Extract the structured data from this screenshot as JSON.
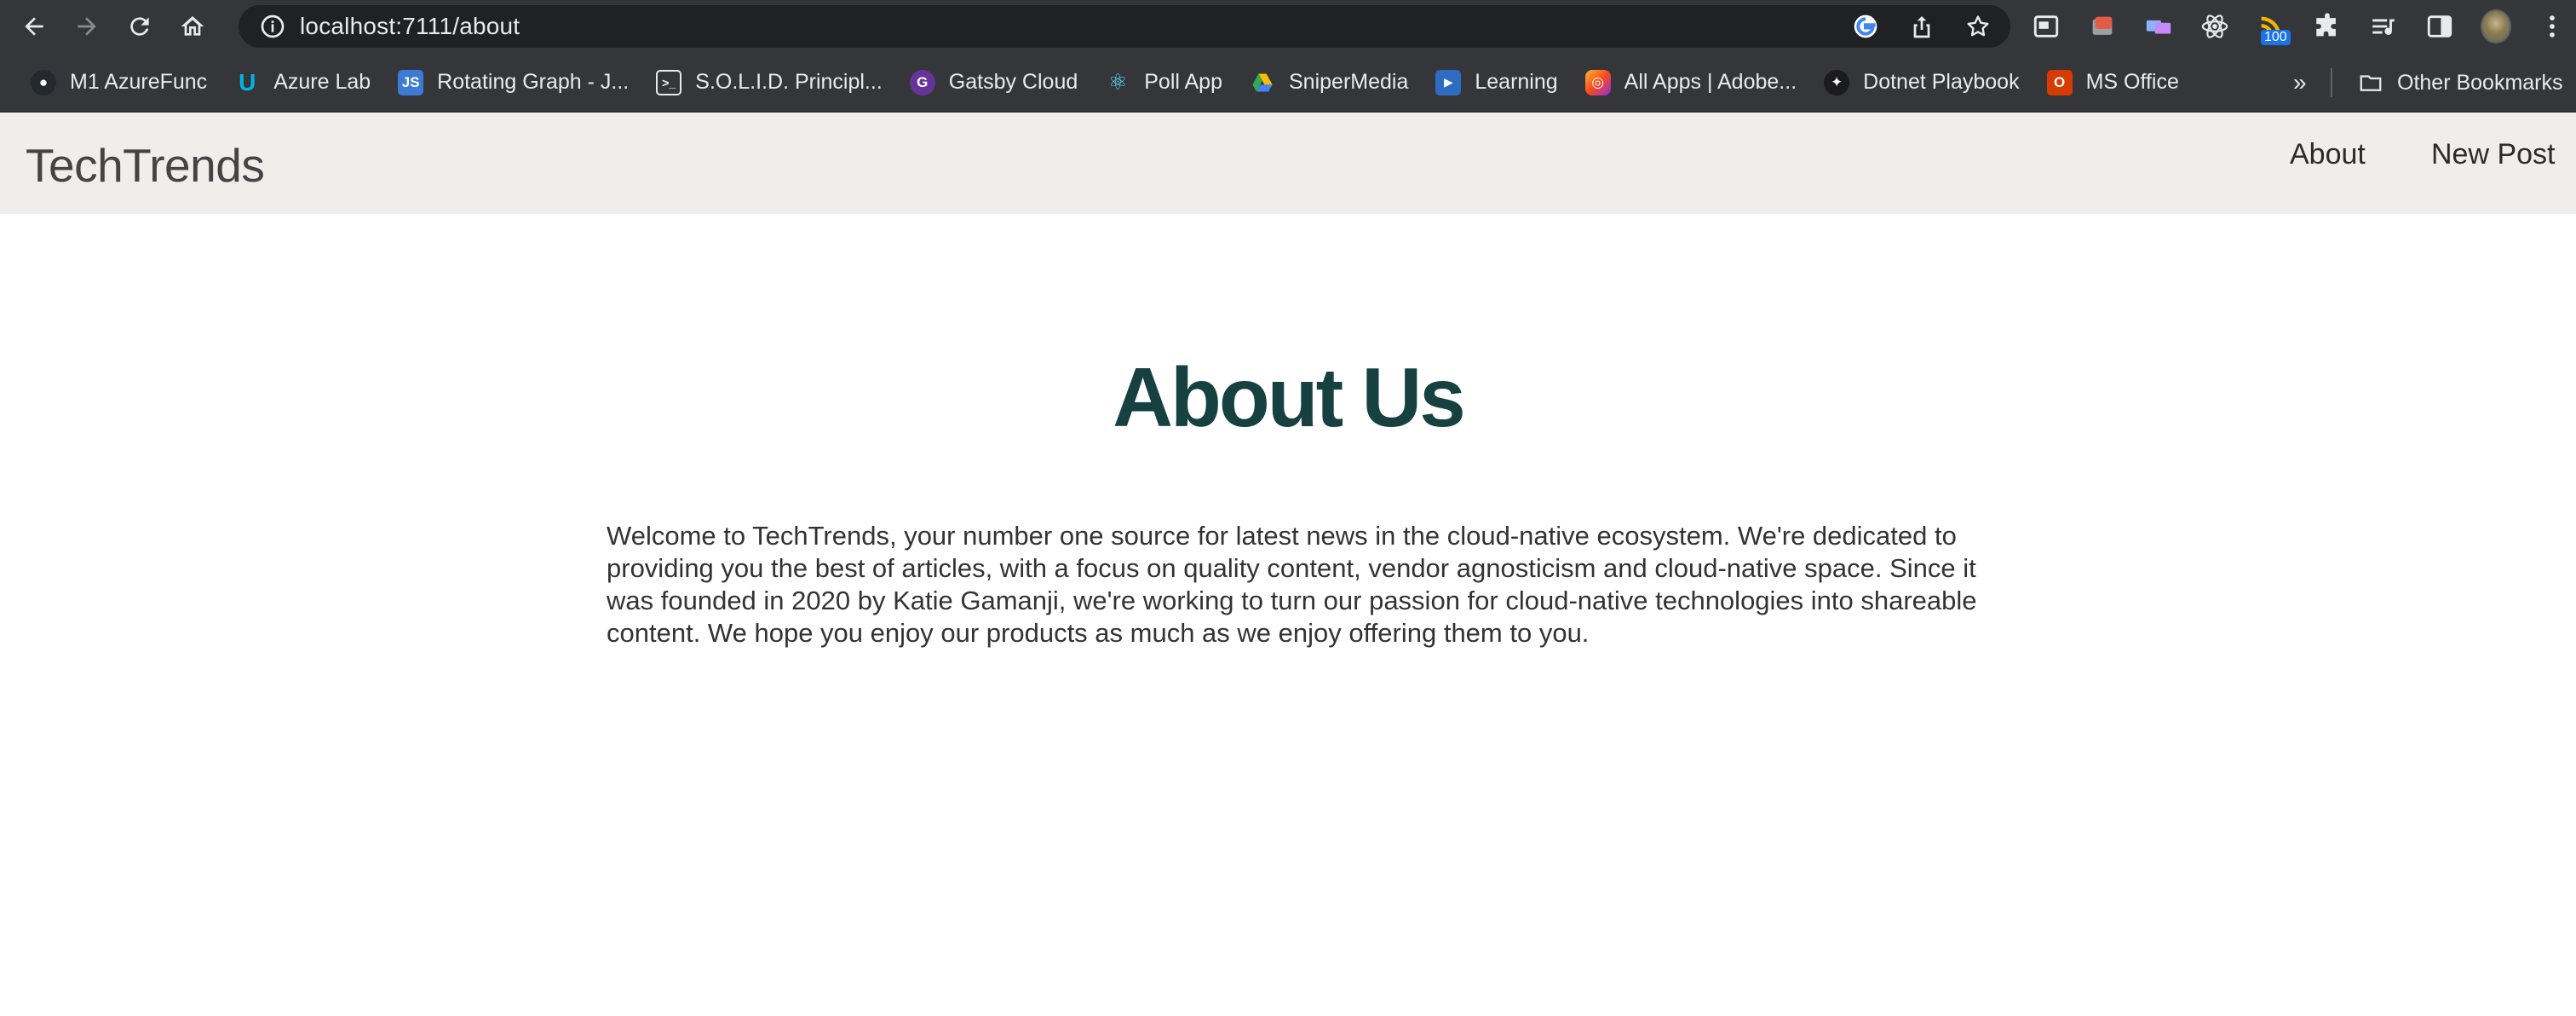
{
  "browser": {
    "url": "localhost:7111/about",
    "extension_badge": "100",
    "bookmarks": [
      {
        "label": "M1 AzureFunc",
        "icon": "github-icon"
      },
      {
        "label": "Azure Lab",
        "icon": "udacity-icon"
      },
      {
        "label": "Rotating Graph - J...",
        "icon": "js-icon"
      },
      {
        "label": "S.O.L.I.D. Principl...",
        "icon": "terminal-icon"
      },
      {
        "label": "Gatsby Cloud",
        "icon": "gatsby-icon"
      },
      {
        "label": "Poll App",
        "icon": "react-icon"
      },
      {
        "label": "SniperMedia",
        "icon": "google-drive-icon"
      },
      {
        "label": "Learning",
        "icon": "video-icon"
      },
      {
        "label": "All Apps | Adobe...",
        "icon": "adobe-icon"
      },
      {
        "label": "Dotnet Playbook",
        "icon": "playbook-icon"
      },
      {
        "label": "MS Office",
        "icon": "office-icon"
      }
    ],
    "overflow": "»",
    "other_bookmarks": "Other Bookmarks"
  },
  "site": {
    "brand": "TechTrends",
    "nav": {
      "about": "About",
      "new_post": "New Post"
    }
  },
  "page": {
    "title": "About Us",
    "body": "Welcome to TechTrends, your number one source for latest news in the cloud-native ecosystem. We're dedicated to providing you the best of articles, with a focus on quality content, vendor agnosticism and cloud-native space. Since it was founded in 2020 by Katie Gamanji, we're working to turn our passion for cloud-native technologies into shareable content. We hope you enjoy our products as much as we enjoy offering them to you."
  },
  "colors": {
    "chrome_bg": "#35363a",
    "omnibox_bg": "#202124",
    "header_bg": "#efeeeb",
    "title": "#174040",
    "body_text": "#333333"
  }
}
